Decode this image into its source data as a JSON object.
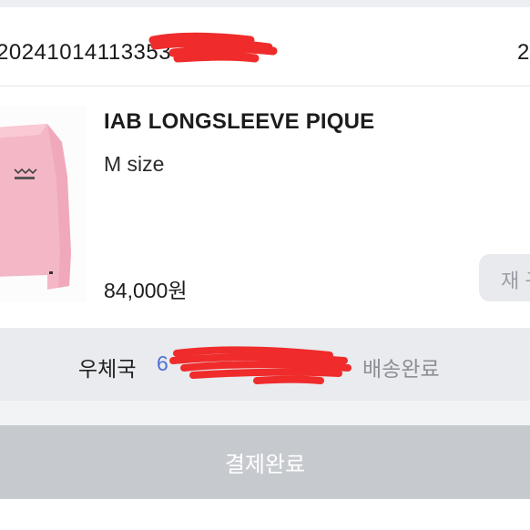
{
  "order": {
    "number": "20241014113353",
    "date_fragment": "2"
  },
  "product": {
    "name": "IAB LONGSLEEVE PIQUE",
    "option": "M size",
    "price": "84,000원",
    "rebuy_label": "재 구"
  },
  "shipping": {
    "carrier": "우체국",
    "tracking_fragment": "6",
    "status": "배송완료"
  },
  "payment": {
    "status_label": "결제완료"
  },
  "colors": {
    "tracking_link": "#4f6fd8",
    "redaction": "#ef2b2b",
    "product_pink": "#f4b7c6"
  }
}
